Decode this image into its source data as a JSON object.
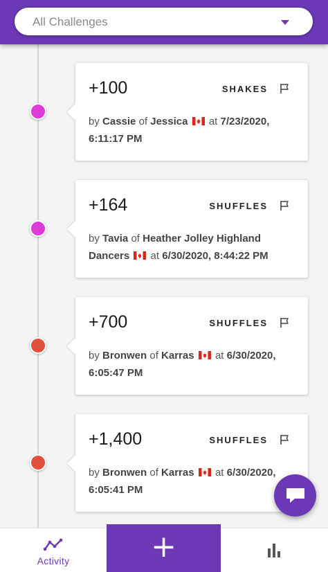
{
  "header": {
    "filter": {
      "selected": "All Challenges"
    }
  },
  "colors": {
    "brand": "#6b38b6",
    "dot_magenta": "#dc3bd8",
    "dot_red": "#e0503b"
  },
  "activities": [
    {
      "points": "+100",
      "category": "SHAKES",
      "by": "by",
      "user": "Cassie",
      "of": "of",
      "team": "Jessica",
      "country_flag": "canada-flag-icon",
      "at": "at",
      "datetime": "7/23/2020, 6:11:17 PM",
      "dot_color": "magenta"
    },
    {
      "points": "+164",
      "category": "SHUFFLES",
      "by": "by",
      "user": "Tavia",
      "of": "of",
      "team": "Heather Jolley Highland Dancers",
      "country_flag": "canada-flag-icon",
      "at": "at",
      "datetime": "6/30/2020, 8:44:22 PM",
      "dot_color": "magenta"
    },
    {
      "points": "+700",
      "category": "SHUFFLES",
      "by": "by",
      "user": "Bronwen",
      "of": "of",
      "team": "Karras",
      "country_flag": "canada-flag-icon",
      "at": "at",
      "datetime": "6/30/2020, 6:05:47 PM",
      "dot_color": "red"
    },
    {
      "points": "+1,400",
      "category": "SHUFFLES",
      "by": "by",
      "user": "Bronwen",
      "of": "of",
      "team": "Karras",
      "country_flag": "canada-flag-icon",
      "at": "at",
      "datetime": "6/30/2020, 6:05:41 PM",
      "dot_color": "red"
    }
  ],
  "fab": {
    "icon": "chat-icon"
  },
  "bottom_nav": {
    "activity_label": "Activity",
    "activity_icon": "activity-line-icon",
    "add_label": "+",
    "stats_icon": "bar-chart-icon"
  }
}
